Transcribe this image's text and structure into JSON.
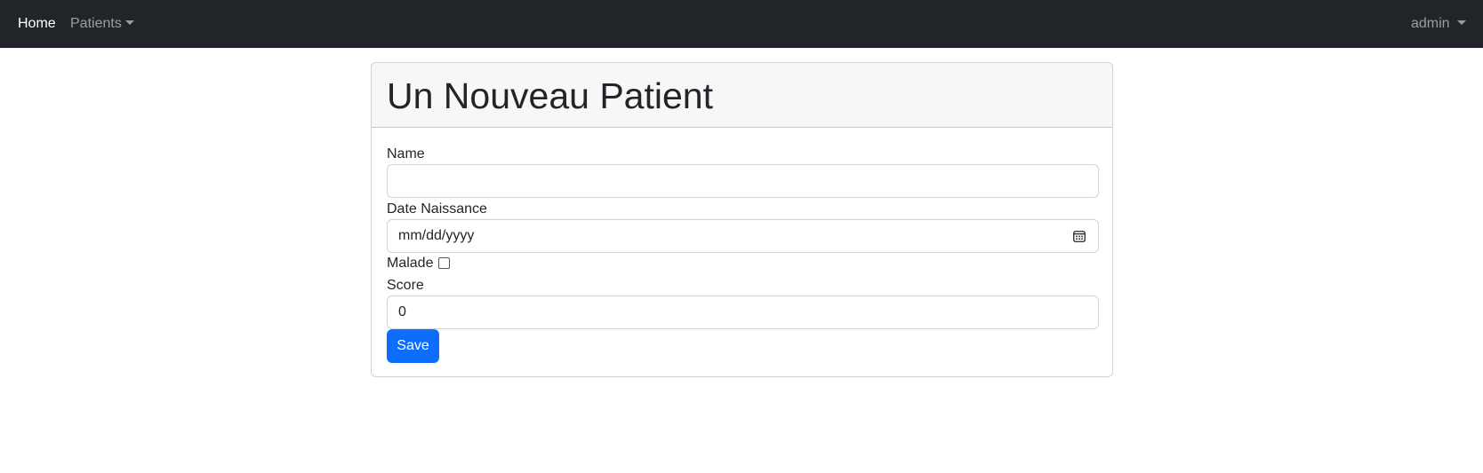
{
  "navbar": {
    "home_label": "Home",
    "patients_label": "Patients",
    "user_label": "admin"
  },
  "form": {
    "title": "Un Nouveau Patient",
    "name_label": "Name",
    "name_value": "",
    "date_label": "Date Naissance",
    "date_placeholder": "mm/dd/yyyy",
    "malade_label": "Malade",
    "malade_checked": false,
    "score_label": "Score",
    "score_value": "0",
    "save_label": "Save"
  },
  "colors": {
    "navbar_bg": "#212529",
    "primary": "#0d6efd",
    "header_bg": "#f7f7f7"
  },
  "icons": {
    "date_picker": "calendar-icon"
  }
}
